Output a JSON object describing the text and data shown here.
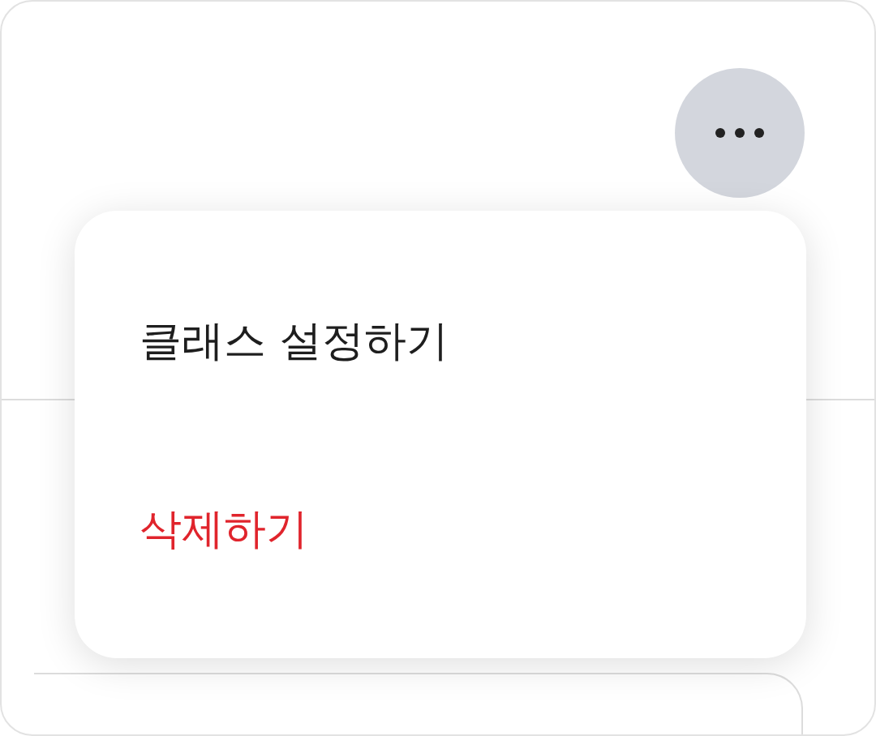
{
  "menu": {
    "items": [
      {
        "label": "클래스 설정하기",
        "kind": "normal"
      },
      {
        "label": "삭제하기",
        "kind": "danger"
      }
    ]
  }
}
